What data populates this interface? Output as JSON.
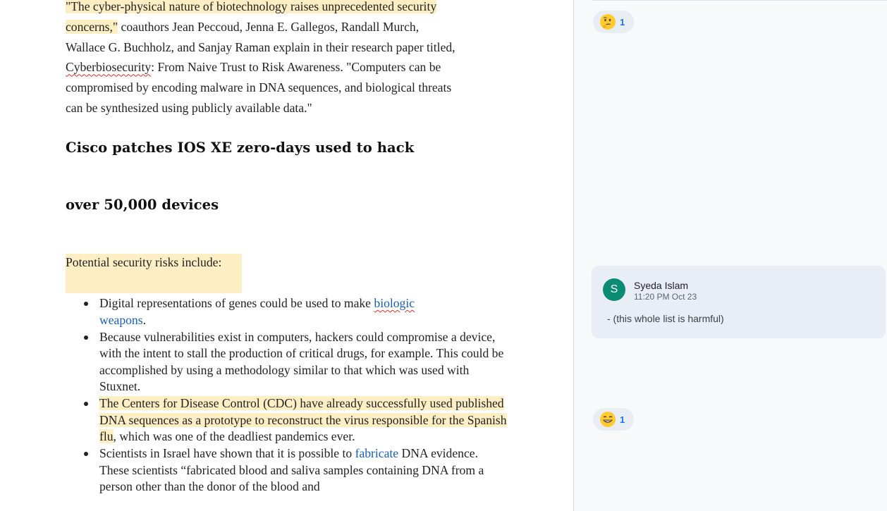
{
  "document": {
    "intro_quote_highlight_line1": "\"The cyber-physical nature of biotechnology raises unprecedented security",
    "intro_quote_highlight_line2": "concerns,\"",
    "intro_rest_1": " coauthors Jean Peccoud, Jenna E. Gallegos, Randall Murch,",
    "intro_line3": "Wallace G. Buchholz, and Sanjay Raman explain in their research paper titled,",
    "intro_title_word": "Cyberbiosecurity",
    "intro_line4_rest": ": From Naive Trust to Risk Awareness. \"Computers can be",
    "intro_line5": "compromised by encoding malware in DNA sequences, and biological threats",
    "intro_line6": "can be synthesized using publicly available data.\"",
    "heading_line1": "Cisco patches IOS XE zero-days used to hack",
    "heading_line2": "over 50,000 devices",
    "risks_label": "Potential security risks include:",
    "bullets": {
      "b1_text": "Digital representations of genes could be used to make ",
      "b1_link1": "biologic",
      "b1_link2": "weapons",
      "b1_end": ".",
      "b2_text": "Because vulnerabilities exist in computers, hackers could compromise a device, with the intent to stall the production of critical drugs, for example. This could be accomplished by using a methodology similar to that which was used with Stuxnet.",
      "b3_highlight": "The Centers for Disease Control (CDC) have already successfully used published DNA sequences as a prototype to reconstruct the virus responsible for the Spanish flu",
      "b3_rest": ", which was one of the deadliest pandemics ever.",
      "b4_text": "Scientists in Israel have shown that it is possible to ",
      "b4_link": "fabricate",
      "b4_rest": " DNA evidence. These scientists “fabricated blood and saliva samples containing DNA from a person other than the donor of the blood and"
    }
  },
  "sidebar": {
    "reaction_top": {
      "icon": "thinking-face-emoji",
      "count": "1"
    },
    "reaction_bottom": {
      "icon": "grinning-face-emoji",
      "count": "1"
    },
    "comment": {
      "avatar_letter": "S",
      "author": "Syeda Islam",
      "time": "11:20 PM Oct 23",
      "body": "- (this whole list is harmful)"
    }
  },
  "colors": {
    "highlight": "#fdefc3",
    "link": "#1a5fb4",
    "avatar": "#0b8a74",
    "comment_card": "#e9eef6"
  }
}
